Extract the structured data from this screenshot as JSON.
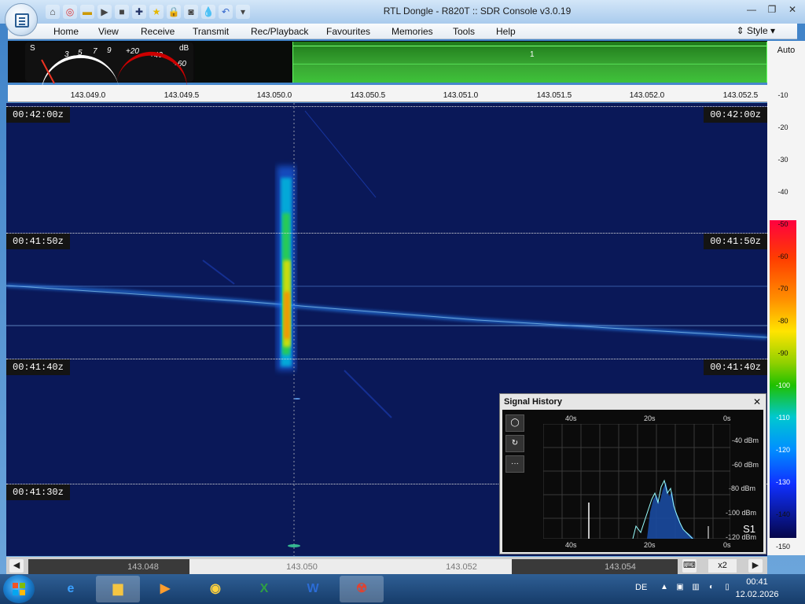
{
  "window": {
    "title": "RTL Dongle - R820T :: SDR Console v3.0.19",
    "controls": [
      "minimize-icon",
      "restore-icon",
      "close-icon"
    ]
  },
  "quick_access": [
    "home-icon",
    "lifebuoy-icon",
    "folder-icon",
    "play-icon",
    "stop-icon",
    "plus-icon",
    "star-icon",
    "lock-icon",
    "camera-icon",
    "drop-icon",
    "undo-icon",
    "dropdown-icon"
  ],
  "menu": [
    "Home",
    "View",
    "Receive",
    "Transmit",
    "Rec/Playback",
    "Favourites",
    "Memories",
    "Tools",
    "Help"
  ],
  "style_ctrl": {
    "label": "Style"
  },
  "meter": {
    "s_label": "S",
    "db_label": "dB",
    "scale_s": [
      "3",
      "5",
      "7",
      "9"
    ],
    "scale_db": [
      "+20",
      "+40",
      "+60"
    ]
  },
  "spectrum": {
    "marker": "1"
  },
  "ruler": {
    "ticks": [
      "143.049.0",
      "143.049.5",
      "143.050.0",
      "143.050.5",
      "143.051.0",
      "143.051.5",
      "143.052.0",
      "143.052.5"
    ]
  },
  "scale": {
    "auto": "Auto",
    "values": [
      "-10",
      "-20",
      "-30",
      "-40",
      "-50",
      "-60",
      "-70",
      "-80",
      "-90",
      "-100",
      "-110",
      "-120",
      "-130",
      "-140",
      "-150"
    ]
  },
  "waterfall": {
    "timestamps": [
      "00:42:00z",
      "00:41:50z",
      "00:41:40z",
      "00:41:30z"
    ]
  },
  "signal_history": {
    "title": "Signal History",
    "top_labels": [
      "40s",
      "20s",
      "0s"
    ],
    "bottom_labels": [
      "40s",
      "20s",
      "0s"
    ],
    "right_labels": [
      "-40 dBm",
      "-60 dBm",
      "-80 dBm",
      "-100 dBm",
      "-120 dBm"
    ],
    "s_reading": "S1",
    "buttons": [
      "record-icon",
      "refresh-icon",
      "more-icon"
    ]
  },
  "bottom_bar": {
    "freqs": [
      "143.048",
      "143.050",
      "143.052",
      "143.054"
    ],
    "zoom": "x2"
  },
  "taskbar": {
    "apps": [
      "Internet Explorer",
      "Explorer",
      "Media Player",
      "Chrome",
      "Excel",
      "Word",
      "SDR Console"
    ],
    "lang": "DE",
    "time": "00:41",
    "date": "12.02.2026"
  },
  "colors": {
    "waterfall_bg": "#08144f",
    "spectrum_green": "#3aa834"
  }
}
